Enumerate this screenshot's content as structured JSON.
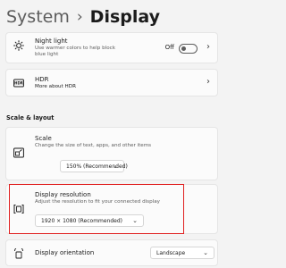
{
  "breadcrumb": {
    "root": "System",
    "separator": "›",
    "current": "Display"
  },
  "night_light": {
    "title": "Night light",
    "description": "Use warmer colors to help block blue light",
    "toggle_state": "Off",
    "icon": "brightness-icon"
  },
  "hdr": {
    "title": "HDR",
    "link": "More about HDR",
    "icon": "hdr-icon"
  },
  "section": {
    "label": "Scale & layout"
  },
  "scale": {
    "title": "Scale",
    "description": "Change the size of text, apps, and other items",
    "selected": "150% (Recommended)",
    "icon": "scale-icon"
  },
  "resolution": {
    "title": "Display resolution",
    "description": "Adjust the resolution to fit your connected display",
    "selected": "1920 × 1080 (Recommended)",
    "icon": "resolution-icon",
    "highlight_color": "#e02020"
  },
  "orientation": {
    "title": "Display orientation",
    "selected": "Landscape",
    "icon": "orientation-icon"
  }
}
